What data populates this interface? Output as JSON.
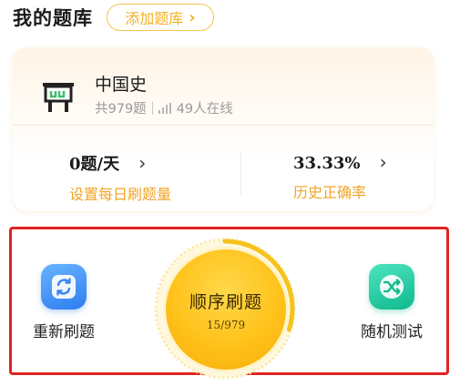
{
  "header": {
    "title": "我的题库",
    "add_button_label": "添加题库",
    "add_button_icon": "chevron-right-icon"
  },
  "subject": {
    "icon": "temple-icon",
    "name": "中国史",
    "question_count": "共979题",
    "online_count": "49人在线"
  },
  "stats": {
    "daily": {
      "value": "0题/天",
      "label": "设置每日刷题量"
    },
    "accuracy": {
      "value": "33.33%",
      "label": "历史正确率"
    }
  },
  "actions": {
    "redo": {
      "label": "重新刷题",
      "icon": "refresh-icon"
    },
    "sequential": {
      "label": "顺序刷题",
      "progress_text": "15/979",
      "progress": 0.0153
    },
    "random": {
      "label": "随机测试",
      "icon": "shuffle-icon"
    }
  },
  "colors": {
    "accent": "#f0a52a",
    "highlight_frame": "#e02424",
    "blue_button": "#2f7df0",
    "green_button": "#10b98c",
    "main_button": "#ffc21a"
  }
}
